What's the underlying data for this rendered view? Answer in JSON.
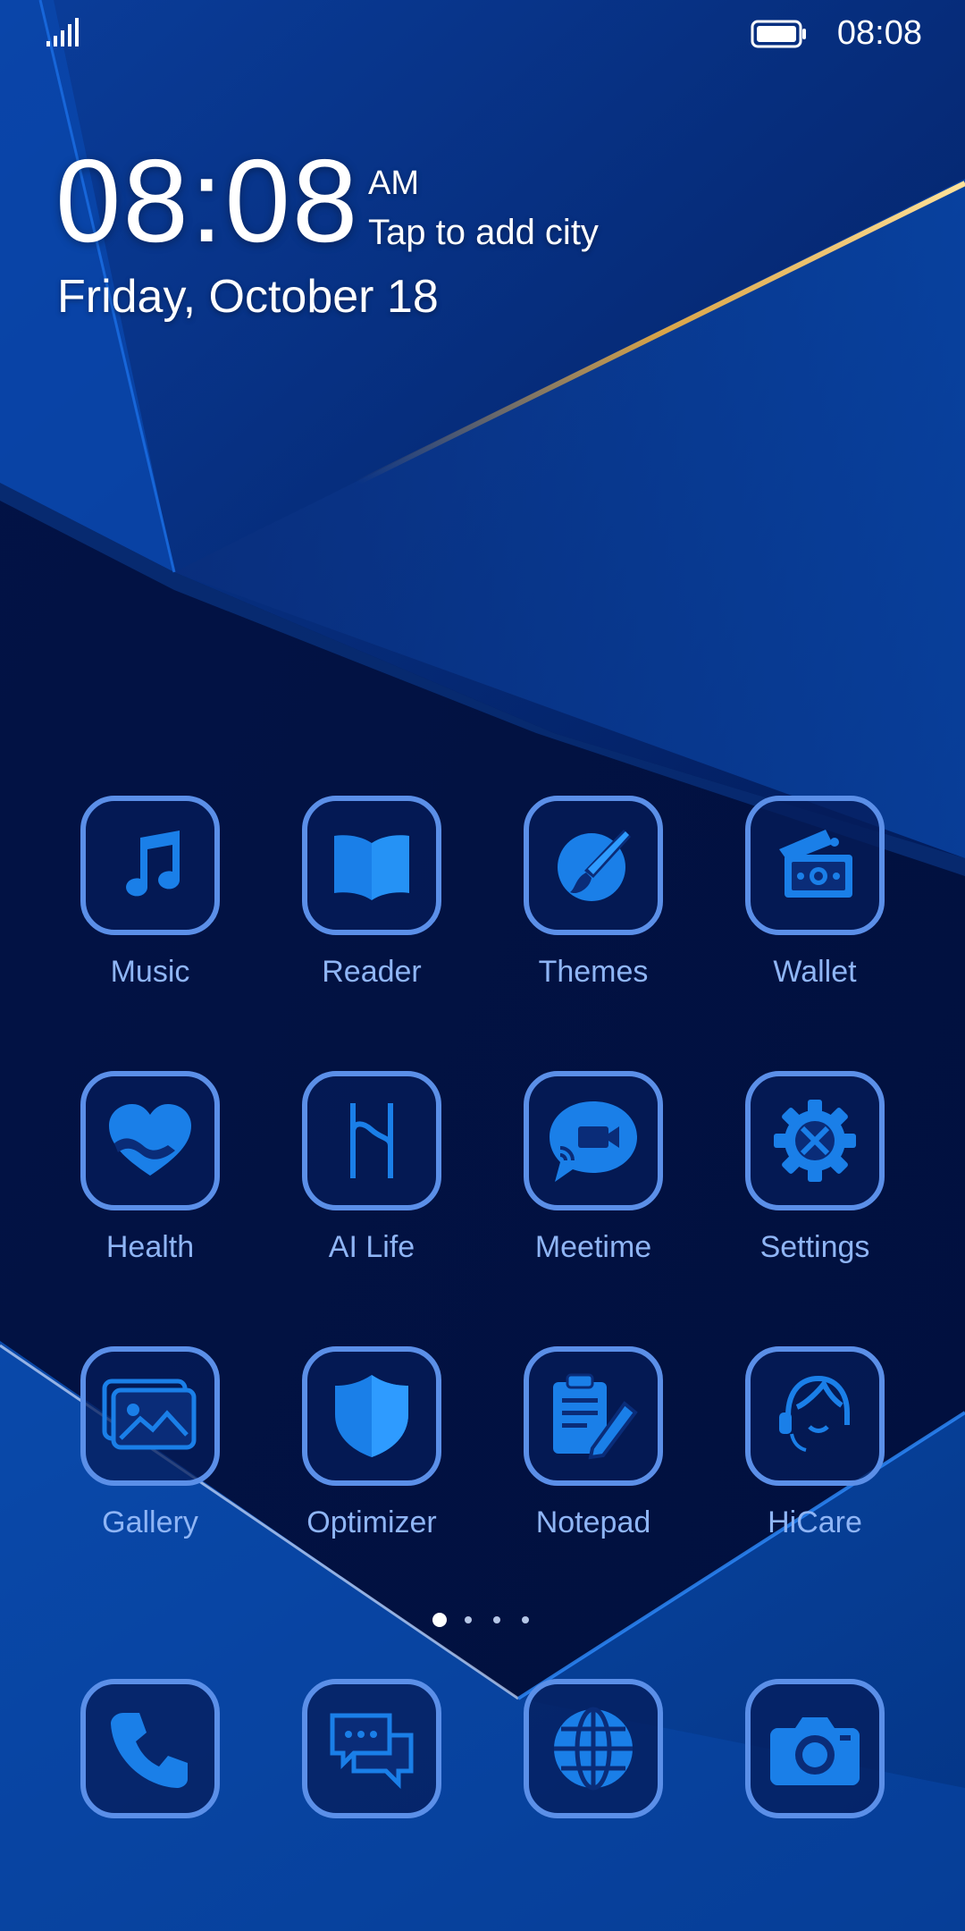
{
  "status_bar": {
    "time": "08:08",
    "signal_icon": "signal-icon",
    "battery_icon": "battery-icon"
  },
  "clock_widget": {
    "time": "08:08",
    "ampm": "AM",
    "city_prompt": "Tap to add city",
    "date": "Friday, October 18"
  },
  "apps": [
    {
      "label": "Music",
      "icon": "music-note-icon"
    },
    {
      "label": "Reader",
      "icon": "book-icon"
    },
    {
      "label": "Themes",
      "icon": "paintbrush-icon"
    },
    {
      "label": "Wallet",
      "icon": "wallet-icon"
    },
    {
      "label": "Health",
      "icon": "heart-icon"
    },
    {
      "label": "AI Life",
      "icon": "ai-life-icon"
    },
    {
      "label": "Meetime",
      "icon": "video-chat-icon"
    },
    {
      "label": "Settings",
      "icon": "gear-icon"
    },
    {
      "label": "Gallery",
      "icon": "image-icon"
    },
    {
      "label": "Optimizer",
      "icon": "shield-icon"
    },
    {
      "label": "Notepad",
      "icon": "notepad-icon"
    },
    {
      "label": "HiCare",
      "icon": "headset-icon"
    }
  ],
  "page_indicator": {
    "pages": 4,
    "current": 1
  },
  "dock": [
    {
      "icon": "phone-icon"
    },
    {
      "icon": "messages-icon"
    },
    {
      "icon": "globe-icon"
    },
    {
      "icon": "camera-icon"
    }
  ],
  "colors": {
    "icon_border": "#5b8fe8",
    "icon_fill": "#1a7fe8",
    "label": "#8fb5f5",
    "background": "#021a52",
    "accent_streak": "#f0b040"
  }
}
